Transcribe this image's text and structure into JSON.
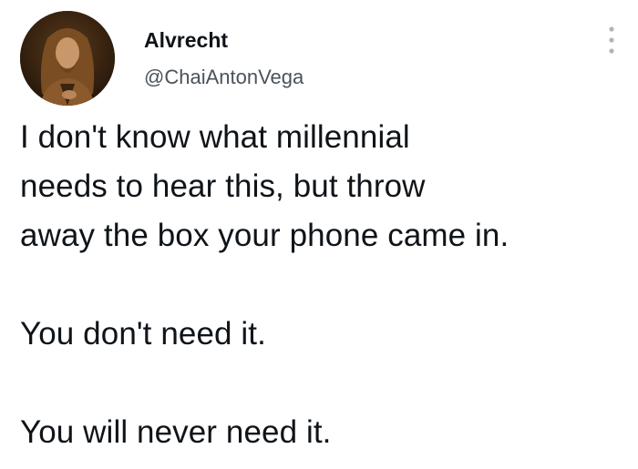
{
  "tweet": {
    "author": {
      "display_name": "Alvrecht",
      "handle": "@ChaiAntonVega",
      "avatar_icon": "portrait-avatar"
    },
    "more_icon": "more-dots-icon",
    "text_lines": [
      "I don't know what millennial",
      "needs to hear this, but throw",
      "away the box your phone came in.",
      "You don't need it.",
      "You will never need it."
    ]
  }
}
